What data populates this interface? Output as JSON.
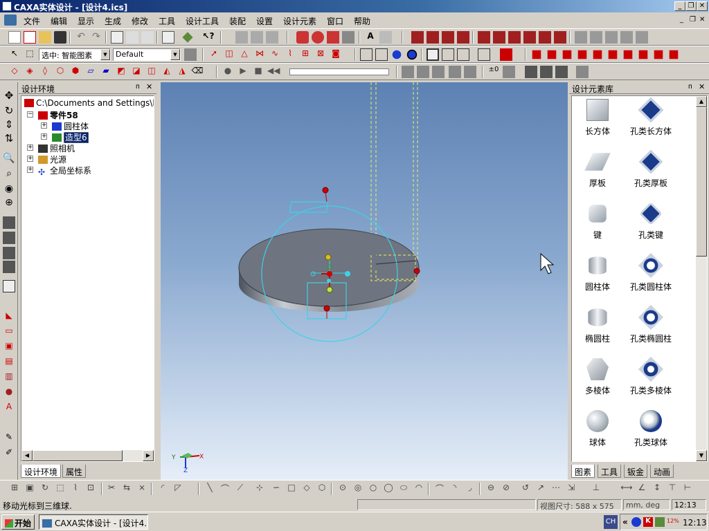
{
  "window": {
    "title": "CAXA实体设计 - [设计4.ics]",
    "min_label": "_",
    "restore_label": "❐",
    "close_label": "✕"
  },
  "menu": {
    "items": [
      "文件",
      "编辑",
      "显示",
      "生成",
      "修改",
      "工具",
      "设计工具",
      "装配",
      "设置",
      "设计元素",
      "窗口",
      "帮助"
    ]
  },
  "toolbar2": {
    "select_combo": "选中: 智能图素",
    "style_combo": "Default"
  },
  "tree_panel": {
    "title": "设计环境",
    "pin_label": "ᴨ",
    "close_label": "✕",
    "root": "C:\\Documents and Settings\\hanshu",
    "part": "零件58",
    "child1": "圆柱体",
    "child2": "造型6",
    "camera": "照相机",
    "light": "光源",
    "coord": "全局坐标系",
    "tabs": [
      "设计环境",
      "属性"
    ]
  },
  "library_panel": {
    "title": "设计元素库",
    "items": [
      {
        "left": "长方体",
        "right": "孔类长方体"
      },
      {
        "left": "厚板",
        "right": "孔类厚板"
      },
      {
        "left": "键",
        "right": "孔类键"
      },
      {
        "left": "圆柱体",
        "right": "孔类圆柱体"
      },
      {
        "left": "椭圆柱",
        "right": "孔类椭圆柱"
      },
      {
        "left": "多棱体",
        "right": "孔类多棱体"
      },
      {
        "left": "球体",
        "right": "孔类球体"
      }
    ],
    "tabs": [
      "图素",
      "工具",
      "钣金",
      "动画"
    ]
  },
  "viewport": {
    "axis_y": "Y",
    "axis_x": "X",
    "axis_z": "Z"
  },
  "status": {
    "message": "移动光标到三维球.",
    "view_size": "视图尺寸: 588 x 575",
    "units": "mm, deg",
    "time": "12:13"
  },
  "taskbar": {
    "start_label": "开始",
    "task_label": "CAXA实体设计 - [设计4...",
    "clock": "12:13",
    "tray_percent": "12%"
  },
  "colors": {
    "title_gradient_start": "#0a246a",
    "title_gradient_end": "#a6caf0",
    "triball": "#3cd2e6",
    "handle_red": "#cc0000",
    "disk_gray": "#6e7480",
    "selection": "#0a246a"
  }
}
